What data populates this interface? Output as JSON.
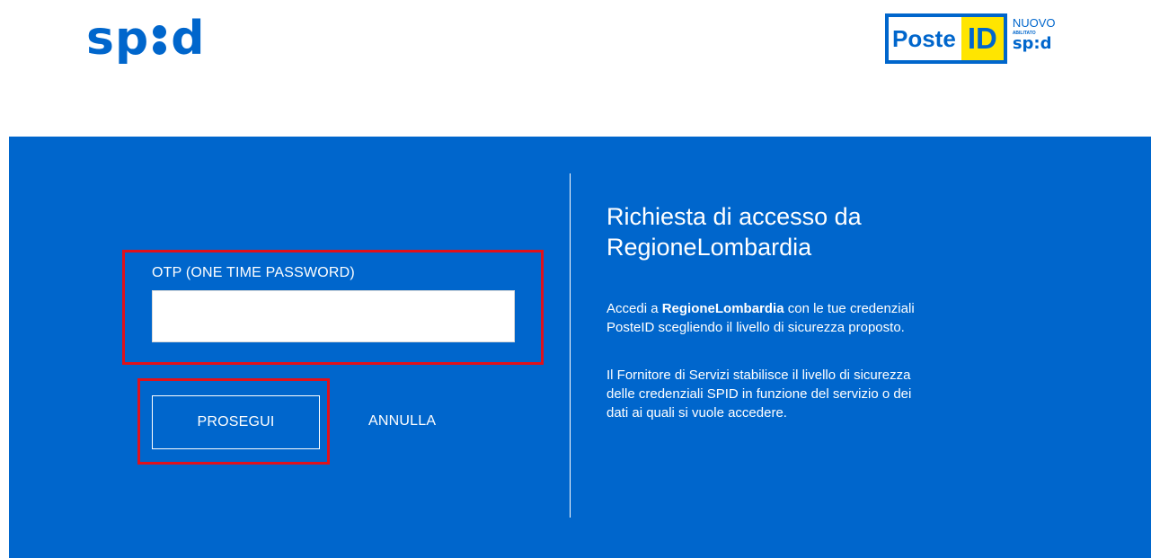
{
  "header": {
    "spid_logo": {
      "before": "sp",
      "after": "d"
    },
    "posteid_logo": {
      "poste": "Poste",
      "id": "ID",
      "nuovo": "NUOVO",
      "abilitato": "ABILITATO",
      "spid_before": "sp",
      "spid_after": "d"
    }
  },
  "colors": {
    "brand_blue": "#0066cc",
    "highlight_red": "#e0111b",
    "id_yellow": "#ffe500"
  },
  "form": {
    "otp_label": "OTP (ONE TIME PASSWORD)",
    "otp_value": "",
    "prosegui_label": "PROSEGUI",
    "annulla_label": "ANNULLA"
  },
  "info": {
    "title_line1": "Richiesta di accesso da",
    "title_line2": "RegioneLombardia",
    "p1_prefix": "Accedi a ",
    "p1_service": "RegioneLombardia",
    "p1_line1_rest": " con le tue credenziali",
    "p1_line2": "PosteID scegliendo il livello di sicurezza proposto.",
    "p2_line1": "Il Fornitore di Servizi stabilisce il livello di sicurezza",
    "p2_line2": "delle credenziali SPID in funzione del servizio o dei",
    "p2_line3": "dati ai quali si vuole accedere."
  }
}
